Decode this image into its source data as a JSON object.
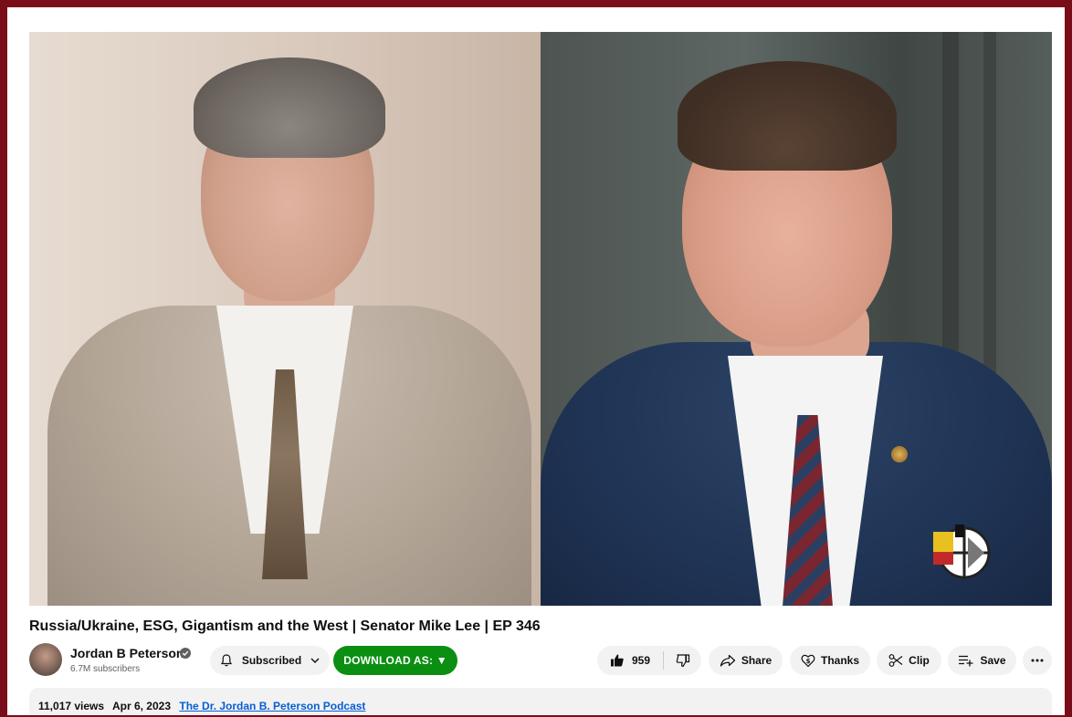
{
  "video": {
    "title": "Russia/Ukraine, ESG, Gigantism and the West | Senator Mike Lee | EP 346"
  },
  "channel": {
    "name": "Jordan B Peterson",
    "subscribers": "6.7M subscribers",
    "verified": true
  },
  "actions": {
    "subscribed_label": "Subscribed",
    "download_label": "DOWNLOAD AS: ▼",
    "like_count": "959",
    "share_label": "Share",
    "thanks_label": "Thanks",
    "clip_label": "Clip",
    "save_label": "Save"
  },
  "description": {
    "views": "11,017 views",
    "date": "Apr 6, 2023",
    "playlist": "The Dr. Jordan B. Peterson Podcast"
  },
  "colors": {
    "page_border": "#7a0d1a",
    "download_button": "#0a8f12",
    "link": "#065fd4"
  },
  "icons": [
    "bell-icon",
    "chevron-down-icon",
    "thumbs-up-icon",
    "thumbs-down-icon",
    "share-arrow-icon",
    "thanks-heart-icon",
    "scissors-icon",
    "playlist-add-icon",
    "more-dots-icon",
    "verified-check-icon",
    "channel-watermark-icon"
  ]
}
